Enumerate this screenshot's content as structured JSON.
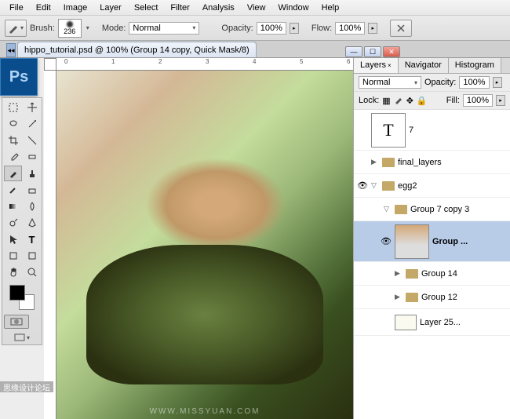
{
  "menu": {
    "items": [
      "File",
      "Edit",
      "Image",
      "Layer",
      "Select",
      "Filter",
      "Analysis",
      "View",
      "Window",
      "Help"
    ]
  },
  "options": {
    "brush_label": "Brush:",
    "brush_size": "236",
    "mode_label": "Mode:",
    "mode_value": "Normal",
    "opacity_label": "Opacity:",
    "opacity_value": "100%",
    "flow_label": "Flow:",
    "flow_value": "100%"
  },
  "doc": {
    "title": "hippo_tutorial.psd @ 100% (Group 14 copy, Quick Mask/8)"
  },
  "ruler_marks": [
    "0",
    "1",
    "2",
    "3",
    "4",
    "5",
    "6"
  ],
  "panels": {
    "tabs": [
      "Layers",
      "Navigator",
      "Histogram"
    ],
    "blend_mode": "Normal",
    "opacity_label": "Opacity:",
    "opacity_value": "100%",
    "lock_label": "Lock:",
    "fill_label": "Fill:",
    "fill_value": "100%",
    "layers": [
      {
        "type": "text",
        "name": "7",
        "thumb": "T"
      },
      {
        "type": "folder",
        "name": "final_layers",
        "expanded": false
      },
      {
        "type": "folder",
        "name": "egg2",
        "expanded": true
      },
      {
        "type": "folder",
        "name": "Group 7 copy 3",
        "expanded": true,
        "indent": 1
      },
      {
        "type": "layer",
        "name": "Group ...",
        "selected": true,
        "indent": 2
      },
      {
        "type": "folder",
        "name": "Group 14",
        "expanded": false,
        "indent": 2
      },
      {
        "type": "folder",
        "name": "Group 12",
        "expanded": false,
        "indent": 2
      },
      {
        "type": "layer-sm",
        "name": "Layer 25...",
        "indent": 2
      }
    ]
  },
  "watermark": "WWW.MISSYUAN.COM",
  "footer": "思缘设计论坛"
}
